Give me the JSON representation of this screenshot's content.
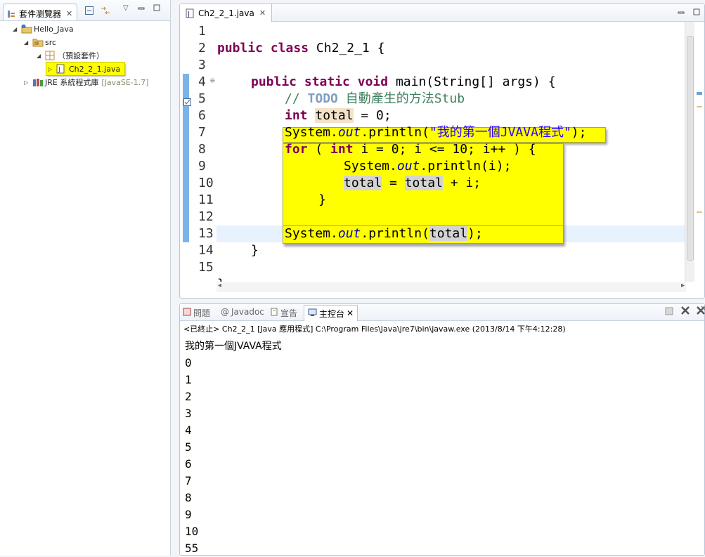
{
  "explorer": {
    "tab_label": "套件瀏覽器",
    "project": "Hello_Java",
    "src": "src",
    "default_package": "（預設套件）",
    "file": "Ch2_2_1.java",
    "jre_label": "JRE 系統程式庫",
    "jre_version": "[JavaSE-1.7]"
  },
  "editor": {
    "tab_label": "Ch2_2_1.java",
    "line_numbers": [
      "1",
      "2",
      "3",
      "4",
      "5",
      "6",
      "7",
      "8",
      "9",
      "10",
      "11",
      "12",
      "13",
      "14",
      "15"
    ],
    "code": {
      "l2": [
        "public",
        "class",
        "Ch2_2_1 {"
      ],
      "l4": [
        "public",
        "static",
        "void",
        "main(String[] args) {"
      ],
      "l5": [
        "// ",
        "TODO",
        " 自動產生的方法Stub"
      ],
      "l6": [
        "int",
        "total",
        " = 0;"
      ],
      "l7": [
        "System.",
        "out",
        ".println(",
        "\"我的第一個JVAVA程式\"",
        ");"
      ],
      "l8": [
        "for",
        " ( ",
        "int",
        " i = 0; i <= 10; i++ ) {"
      ],
      "l9": [
        "System.",
        "out",
        ".println(i);"
      ],
      "l10": [
        "total",
        " = ",
        "total",
        " + i;"
      ],
      "l11": "}",
      "l12": [
        "System.",
        "out",
        ".println(",
        "total",
        ");"
      ],
      "l13": "}",
      "l15": "}"
    }
  },
  "console": {
    "tabs": [
      "問題",
      "Javadoc",
      "宣告",
      "主控台"
    ],
    "info": "<已終止> Ch2_2_1 [Java 應用程式] C:\\Program Files\\Java\\jre7\\bin\\javaw.exe (2013/8/14 下午4:12:28)",
    "output": [
      "我的第一個JVAVA程式",
      "0",
      "1",
      "2",
      "3",
      "4",
      "5",
      "6",
      "7",
      "8",
      "9",
      "10",
      "55"
    ]
  }
}
